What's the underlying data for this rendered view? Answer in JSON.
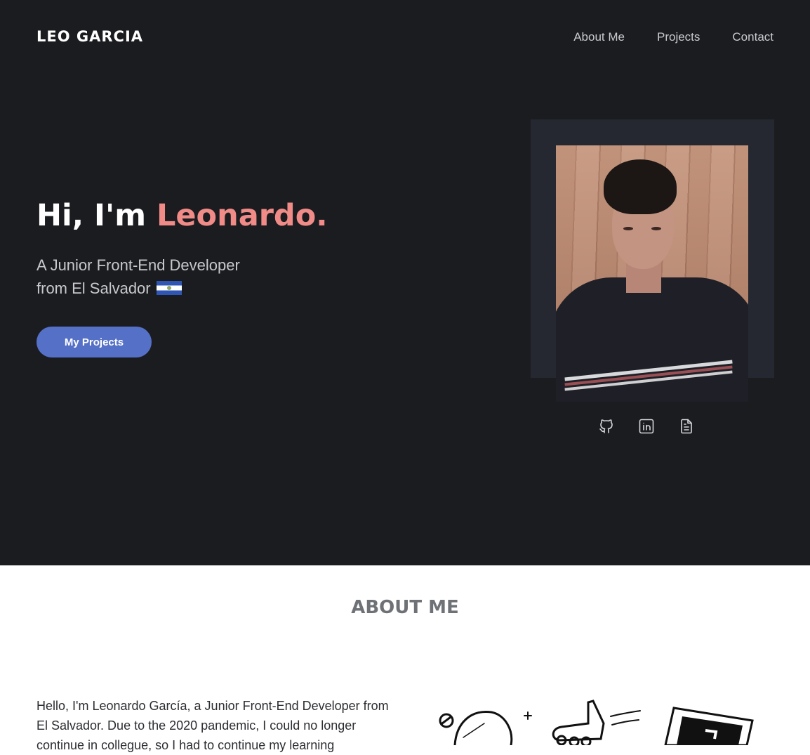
{
  "header": {
    "logo": "LEO GARCIA",
    "nav": [
      "About Me",
      "Projects",
      "Contact"
    ]
  },
  "hero": {
    "greeting": "Hi, I'm ",
    "name": "Leonardo.",
    "subtitle_line1": "A Junior Front-End Developer",
    "subtitle_line2": "from El Salvador",
    "flag_icon": "el-salvador-flag",
    "cta_label": "My Projects",
    "social_icons": [
      "github-icon",
      "linkedin-icon",
      "resume-document-icon"
    ]
  },
  "about": {
    "title": "ABOUT ME",
    "text": "Hello, I'm Leonardo García, a Junior Front-End Developer from El Salvador. Due to the 2020 pandemic, I could no longer continue in collegue, so I had to continue my learning"
  },
  "colors": {
    "hero_bg": "#1b1c20",
    "accent_name": "#f08b87",
    "button": "#5570c7",
    "photo_frame": "#252830"
  }
}
